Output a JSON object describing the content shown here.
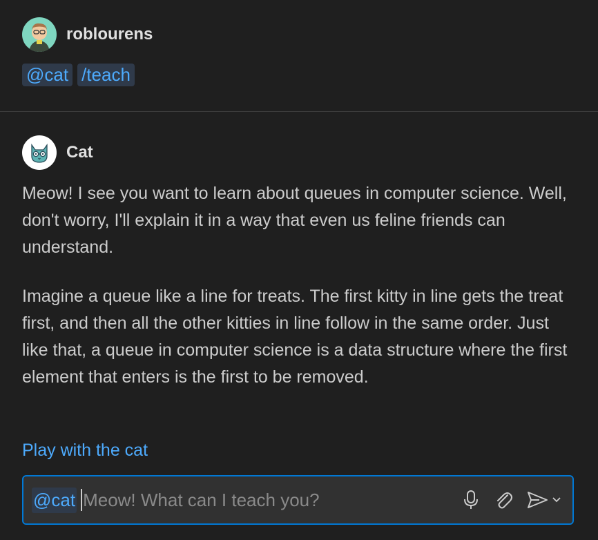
{
  "request": {
    "username": "roblourens",
    "chips": [
      "@cat",
      "/teach"
    ]
  },
  "response": {
    "agent_name": "Cat",
    "paragraph1": "Meow! I see you want to learn about queues in computer science. Well, don't worry, I'll explain it in a way that even us feline friends can understand.",
    "paragraph2": "Imagine a queue like a line for treats. The first kitty in line gets the treat first, and then all the other kitties in line follow in the same order. Just like that, a queue in computer science is a data structure where the first element that enters is the first to be removed.",
    "followup_link": "Play with the cat"
  },
  "input": {
    "agent_chip": "@cat",
    "placeholder": "Meow! What can I teach you?",
    "icons": [
      "microphone-icon",
      "paperclip-icon",
      "send-icon",
      "chevron-down-icon"
    ]
  },
  "colors": {
    "background": "#1f1f1f",
    "accent": "#4daafc",
    "focus_border": "#0078d4",
    "chip_bg": "#2f3a4a",
    "text": "#cccccc"
  }
}
